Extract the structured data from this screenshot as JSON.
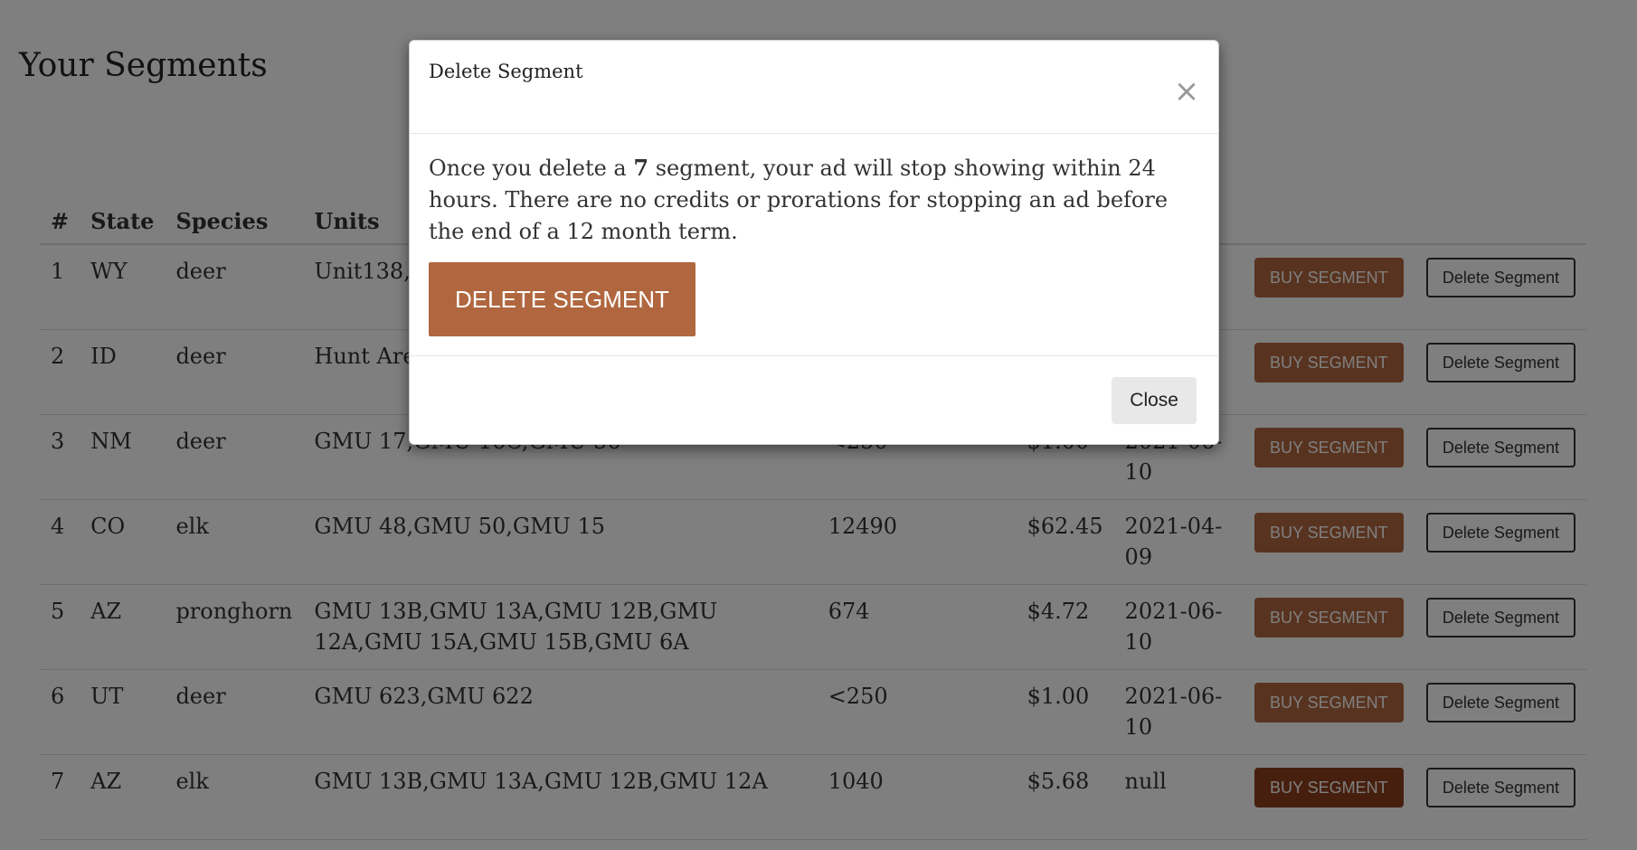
{
  "page": {
    "title": "Your Segments"
  },
  "table": {
    "headers": [
      "#",
      "State",
      "Species",
      "Units",
      "",
      "",
      "",
      "",
      ""
    ],
    "rows": [
      {
        "num": "1",
        "state": "WY",
        "species": "deer",
        "units": "Unit138,Unit",
        "size": "",
        "price": "",
        "date": ""
      },
      {
        "num": "2",
        "state": "ID",
        "species": "deer",
        "units": "Hunt Area",
        "size": "",
        "price": "",
        "date": ""
      },
      {
        "num": "3",
        "state": "NM",
        "species": "deer",
        "units": "GMU 17,GMU 16C,GMU 56",
        "size": "<250",
        "price": "$1.00",
        "date": "2021-06-10"
      },
      {
        "num": "4",
        "state": "CO",
        "species": "elk",
        "units": "GMU 48,GMU 50,GMU 15",
        "size": "12490",
        "price": "$62.45",
        "date": "2021-04-09"
      },
      {
        "num": "5",
        "state": "AZ",
        "species": "pronghorn",
        "units": "GMU 13B,GMU 13A,GMU 12B,GMU 12A,GMU 15A,GMU 15B,GMU 6A",
        "size": "674",
        "price": "$4.72",
        "date": "2021-06-10"
      },
      {
        "num": "6",
        "state": "UT",
        "species": "deer",
        "units": "GMU 623,GMU 622",
        "size": "<250",
        "price": "$1.00",
        "date": "2021-06-10"
      },
      {
        "num": "7",
        "state": "AZ",
        "species": "elk",
        "units": "GMU 13B,GMU 13A,GMU 12B,GMU 12A",
        "size": "1040",
        "price": "$5.68",
        "date": "null"
      }
    ],
    "buy_label": "BUY SEGMENT",
    "delete_label": "Delete Segment"
  },
  "modal": {
    "title": "Delete Segment",
    "close_symbol": "×",
    "message_before": "Once you delete a ",
    "segment_number": "7",
    "message_after": " segment, your ad will stop showing within 24 hours. There are no credits or prorations for stopping an ad before the end of a 12 month term.",
    "delete_button": "DELETE SEGMENT",
    "close_button": "Close"
  },
  "colors": {
    "accent": "#b0673f",
    "accent_active": "#8e3f1d",
    "overlay": "rgba(0,0,0,0.5)"
  }
}
